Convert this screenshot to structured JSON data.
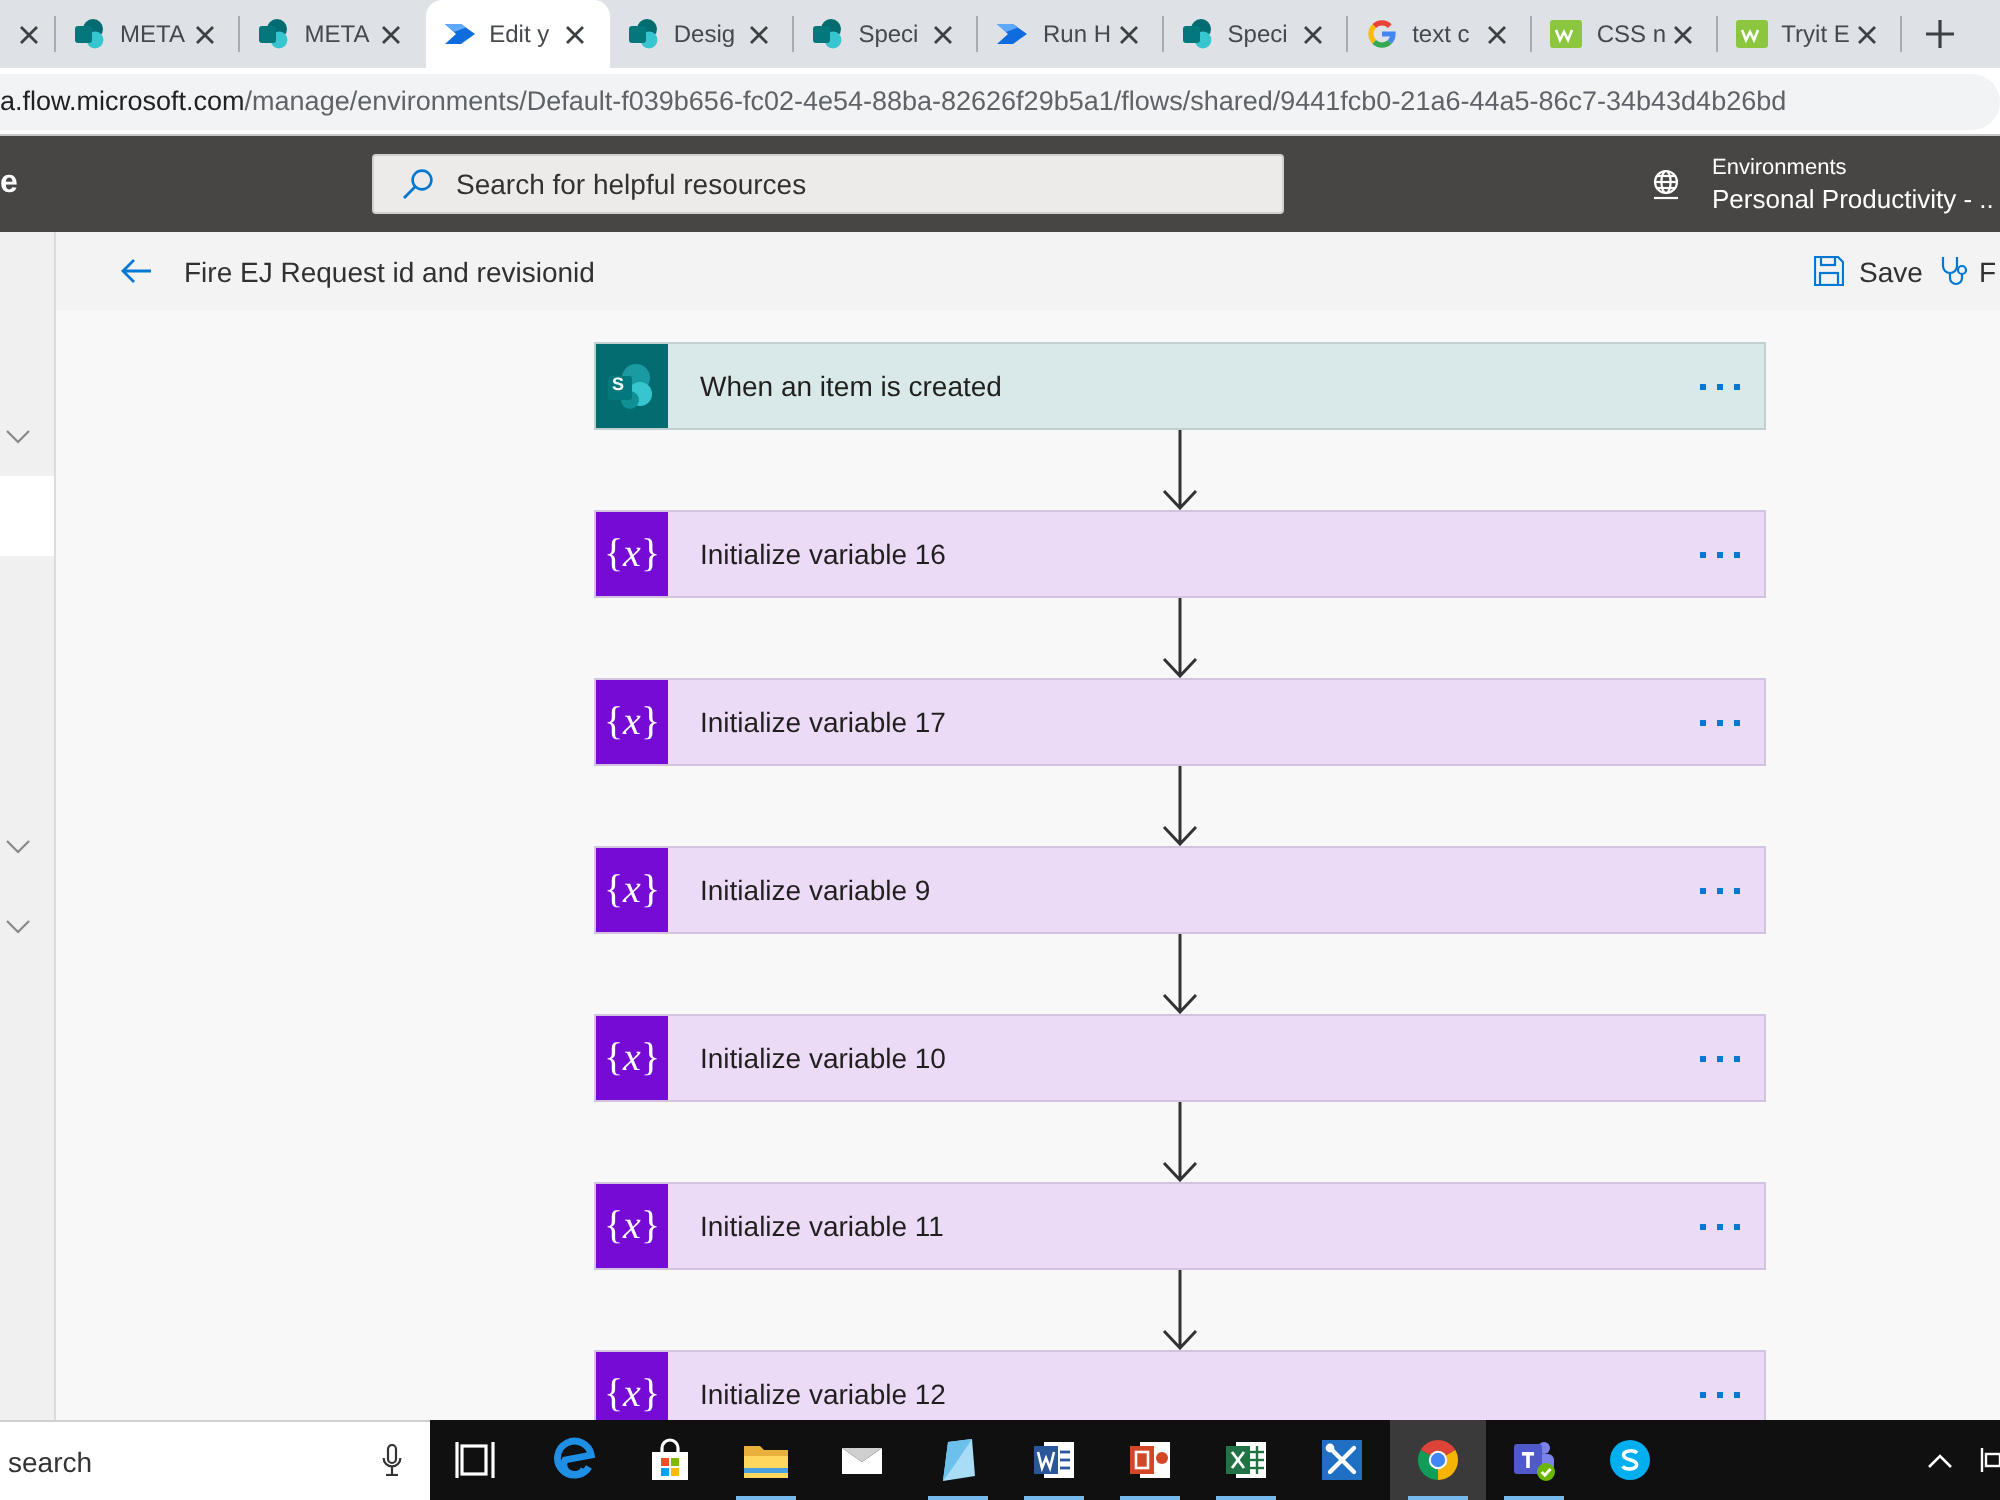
{
  "browser": {
    "tabs": [
      {
        "kind": "cut",
        "selected": false
      },
      {
        "kind": "sharepoint",
        "title": "META",
        "selected": false
      },
      {
        "kind": "sharepoint",
        "title": "META",
        "selected": false
      },
      {
        "kind": "flow",
        "title": "Edit y",
        "selected": true
      },
      {
        "kind": "sharepoint",
        "title": "Desig",
        "selected": false
      },
      {
        "kind": "sharepoint",
        "title": "Speci",
        "selected": false
      },
      {
        "kind": "flow",
        "title": "Run H",
        "selected": false
      },
      {
        "kind": "sharepoint",
        "title": "Speci",
        "selected": false
      },
      {
        "kind": "google",
        "title": "text c",
        "selected": false
      },
      {
        "kind": "w3",
        "title": "CSS n",
        "selected": false
      },
      {
        "kind": "w3",
        "title": "Tryit E",
        "selected": false
      }
    ],
    "address": {
      "host": "a.flow.microsoft.com",
      "path": "/manage/environments/Default-f039b656-fc02-4e54-88ba-82626f29b5a1/flows/shared/9441fcb0-21a6-44a5-86c7-34b43d4b26bd"
    }
  },
  "header": {
    "app_title": "e",
    "search": {
      "placeholder": "Search for helpful resources"
    },
    "environment": {
      "label": "Environments",
      "value": "Personal Productivity - .."
    }
  },
  "sidebar": {
    "items": [
      {
        "kind": "group",
        "selected": false
      },
      {
        "kind": "page",
        "selected": true
      },
      {
        "kind": "group",
        "selected": false
      },
      {
        "kind": "group",
        "selected": false
      }
    ]
  },
  "toolbar": {
    "title": "Fire EJ Request id and revisionid",
    "actions": [
      {
        "kind": "save",
        "label": "Save"
      },
      {
        "kind": "checker",
        "label": "F"
      }
    ]
  },
  "flow": {
    "steps": [
      {
        "kind": "trigger",
        "icon_text": "S",
        "title": "When an item is created"
      },
      {
        "kind": "variable",
        "icon_text": "{*x*}",
        "title": "Initialize variable 16"
      },
      {
        "kind": "variable",
        "icon_text": "{*x*}",
        "title": "Initialize variable 17"
      },
      {
        "kind": "variable",
        "icon_text": "{*x*}",
        "title": "Initialize variable 9"
      },
      {
        "kind": "variable",
        "icon_text": "{*x*}",
        "title": "Initialize variable 10"
      },
      {
        "kind": "variable",
        "icon_text": "{*x*}",
        "title": "Initialize variable 11"
      },
      {
        "kind": "variable",
        "icon_text": "{*x*}",
        "title": "Initialize variable 12"
      }
    ]
  },
  "taskbar": {
    "search": {
      "placeholder": "search"
    },
    "apps": [
      {
        "kind": "task-view",
        "running": false,
        "selected": false
      },
      {
        "kind": "edge",
        "running": false,
        "selected": false
      },
      {
        "kind": "store",
        "running": false,
        "selected": false
      },
      {
        "kind": "explorer",
        "running": true,
        "selected": false
      },
      {
        "kind": "mail",
        "running": false,
        "selected": false
      },
      {
        "kind": "viewer",
        "running": true,
        "selected": false
      },
      {
        "kind": "word",
        "running": true,
        "selected": false
      },
      {
        "kind": "powerpoint",
        "running": true,
        "selected": false
      },
      {
        "kind": "excel",
        "running": true,
        "selected": false
      },
      {
        "kind": "tools",
        "running": false,
        "selected": false
      },
      {
        "kind": "chrome",
        "running": true,
        "selected": true
      },
      {
        "kind": "teams",
        "running": true,
        "selected": false
      },
      {
        "kind": "skype",
        "running": false,
        "selected": false
      }
    ]
  }
}
